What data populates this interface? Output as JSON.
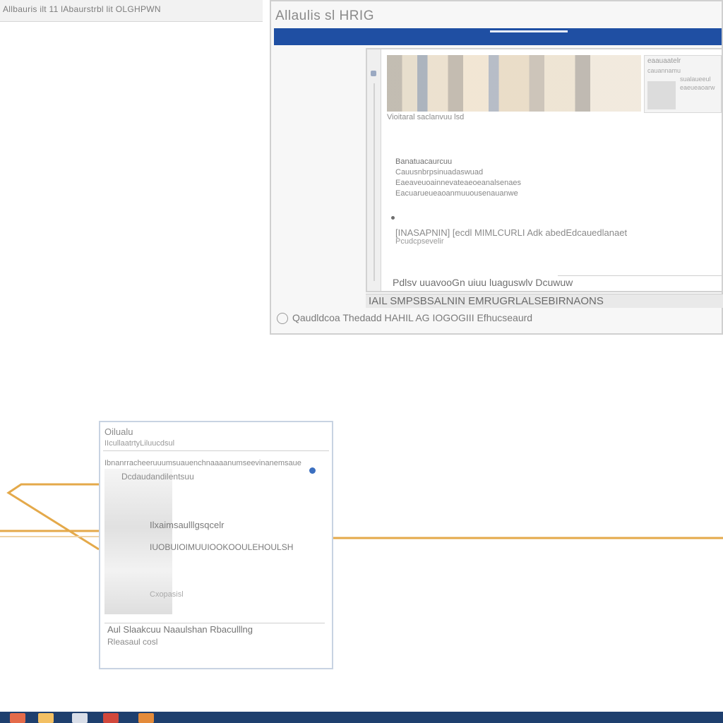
{
  "top_strip": {
    "text": "Allbauris ilt 11 lAbaurstrbl lit OLGHPWN"
  },
  "main_window": {
    "title": "Allaulis  sl  HRIG",
    "content": {
      "thumb_caption": "Vioitaral saclanvuu lsd",
      "side_card": {
        "head": "eaauaatelr",
        "lines": [
          "cauannamu",
          "sualaueeul",
          "eaeueaoarw"
        ]
      },
      "text_lines": [
        "Banatuacaurcuu",
        "Cauusnbrpsinuadaswuad",
        "Eaeaveuoainnevateaeoeanalsenaes",
        "Eacuarueueaoanmuuousenauanwe"
      ],
      "note_main": "[INASAPNIN]  [ecdl MIMLCURLI Adk abedEdcauedlanaet",
      "note_sub": "Pcudcpsevelir",
      "status": "Pdlsv uuavooGn  uiuu  luaguswlv  Dcuwuw"
    },
    "bar1": "IAIL SMPSBSALNIN  EMRUGRLALSEBIRNAONS",
    "bar2": "Qaudldcoa   Thedadd HAHIL AG  IOGOGIII  Efhucseaurd"
  },
  "small_window": {
    "title": "Oilualu",
    "subtitle": "IIcullaatrtyLiluucdsul",
    "row1": "Ibnanrracheeruuumsuauenchnaaaanumseevinanemsaue",
    "row2": "Dcdaudandilentsuu",
    "label1": "Ilxaimsaulllgsqcelr",
    "label2": "IUOBUIOIMUUIOOKOOULEHOULSH",
    "label3": "Cxopasisl",
    "foot1": "Aul Slaakcuu Naaulshan Rbaculllng",
    "foot2": "Rleasaul cosl"
  },
  "colors": {
    "accent_blue": "#1f4fa3",
    "connector_orange": "#e4a94a",
    "taskbar": "#1e3f6e"
  },
  "taskbar": {
    "icons": [
      "app-icon-1",
      "folder-icon",
      "app-icon-3",
      "app-icon-4",
      "app-icon-5"
    ]
  }
}
